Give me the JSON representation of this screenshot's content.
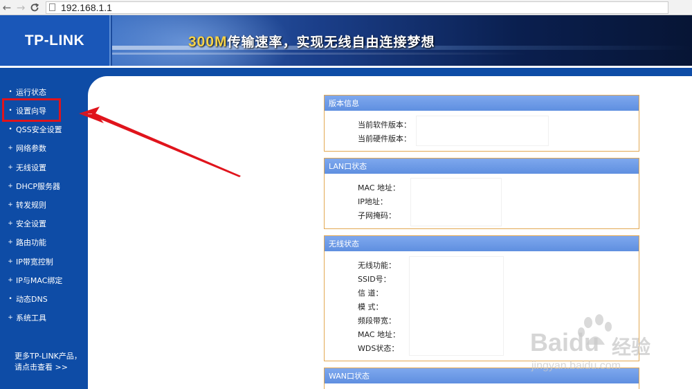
{
  "browser": {
    "back_icon": "arrow-left-icon",
    "forward_icon": "arrow-right-icon",
    "reload_icon": "reload-icon",
    "url": "192.168.1.1"
  },
  "header": {
    "logo": "TP-LINK",
    "slogan_highlight": "300M",
    "slogan_rest": "传输速率，实现无线自由连接梦想"
  },
  "sidebar": {
    "items": [
      {
        "label": "运行状态",
        "bullet": "•"
      },
      {
        "label": "设置向导",
        "bullet": "•"
      },
      {
        "label": "QSS安全设置",
        "bullet": "•"
      },
      {
        "label": "网络参数",
        "bullet": "+"
      },
      {
        "label": "无线设置",
        "bullet": "+"
      },
      {
        "label": "DHCP服务器",
        "bullet": "+"
      },
      {
        "label": "转发规则",
        "bullet": "+"
      },
      {
        "label": "安全设置",
        "bullet": "+"
      },
      {
        "label": "路由功能",
        "bullet": "+"
      },
      {
        "label": "IP带宽控制",
        "bullet": "+"
      },
      {
        "label": "IP与MAC绑定",
        "bullet": "+"
      },
      {
        "label": "动态DNS",
        "bullet": "•"
      },
      {
        "label": "系统工具",
        "bullet": "+"
      }
    ],
    "more_line1": "更多TP-LINK产品，",
    "more_line2": "请点击查看 >>"
  },
  "panels": {
    "version": {
      "title": "版本信息",
      "rows": [
        "当前软件版本：",
        "当前硬件版本："
      ]
    },
    "lan": {
      "title": "LAN口状态",
      "rows": [
        "MAC 地址：",
        "IP地址：",
        "子网掩码："
      ]
    },
    "wireless": {
      "title": "无线状态",
      "rows": [
        "无线功能：",
        "SSID号：",
        "信 道：",
        "模 式：",
        "频段带宽：",
        "MAC 地址：",
        "WDS状态："
      ]
    },
    "wan": {
      "title": "WAN口状态"
    }
  },
  "watermark": {
    "brand": "Baidu",
    "brand_cn": "经验",
    "url": "jingyan.baidu.com"
  },
  "colors": {
    "sidebar_bg": "#0e4ca6",
    "panel_header": "#6a98e6",
    "panel_border": "#e2a852",
    "highlight": "#e0141c"
  }
}
